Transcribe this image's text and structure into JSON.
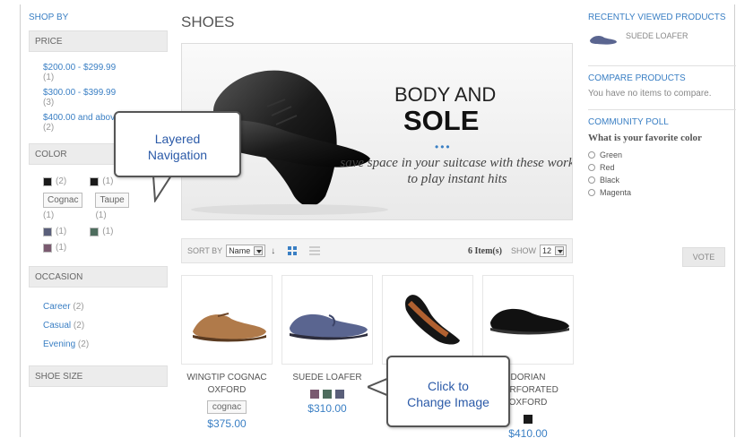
{
  "sidebar": {
    "shop_by": "SHOP BY",
    "price": {
      "header": "PRICE",
      "items": [
        {
          "label": "$200.00 - $299.99",
          "count": "(1)"
        },
        {
          "label": "$300.00 - $399.99",
          "count": "(3)"
        },
        {
          "label": "$400.00 and above",
          "count": "(2)"
        }
      ]
    },
    "color": {
      "header": "COLOR",
      "row1": [
        {
          "count": "(2)",
          "color": "#1a1a1a"
        },
        {
          "count": "(1)",
          "color": "#1a1a1a"
        }
      ],
      "row2": [
        {
          "label": "Cognac",
          "count": "(1)"
        },
        {
          "label": "Taupe",
          "count": "(1)"
        }
      ],
      "row3": [
        {
          "count": "(1)",
          "color": "#5a5f7a"
        },
        {
          "count": "(1)",
          "color": "#4e6d5e"
        }
      ],
      "row4": [
        {
          "count": "(1)",
          "color": "#7a5a70"
        }
      ]
    },
    "occasion": {
      "header": "OCCASION",
      "items": [
        {
          "label": "Career",
          "count": "(2)"
        },
        {
          "label": "Casual",
          "count": "(2)"
        },
        {
          "label": "Evening",
          "count": "(2)"
        }
      ]
    },
    "shoe_size": {
      "header": "SHOE SIZE"
    }
  },
  "main": {
    "title": "SHOES",
    "banner": {
      "line1": "BODY AND",
      "line2": "SOLE",
      "dots": "•••",
      "tagline": "save space in your suitcase with these work to play instant hits"
    },
    "toolbar": {
      "sort_label": "SORT BY",
      "sort_value": "Name",
      "sort_dir_icon": "↓",
      "items_count": "6 Item(s)",
      "show_label": "SHOW",
      "show_value": "12"
    },
    "products": [
      {
        "name": "WINGTIP COGNAC OXFORD",
        "tag": "cognac",
        "price": "$375.00"
      },
      {
        "name": "SUEDE LOAFER",
        "price": "$310.00",
        "swatches": [
          "#7a5a70",
          "#4e6d5e",
          "#5a5f7a"
        ]
      },
      {
        "name": ""
      },
      {
        "name": "DORIAN PERFORATED OXFORD",
        "price": "$410.00",
        "swatches": [
          "#1a1a1a"
        ]
      }
    ]
  },
  "right": {
    "recent_header": "RECENTLY VIEWED PRODUCTS",
    "recent_item": "SUEDE LOAFER",
    "compare_header": "COMPARE PRODUCTS",
    "compare_text": "You have no items to compare.",
    "poll_header": "COMMUNITY POLL",
    "poll_question": "What is your favorite color",
    "poll_options": [
      "Green",
      "Red",
      "Black",
      "Magenta"
    ],
    "vote_label": "VOTE"
  },
  "callouts": {
    "layered": [
      "Layered",
      "Navigation"
    ],
    "click": [
      "Click to",
      "Change Image"
    ]
  },
  "colors": {
    "link": "#3a7fc4",
    "callout_text": "#2b5aa8"
  }
}
